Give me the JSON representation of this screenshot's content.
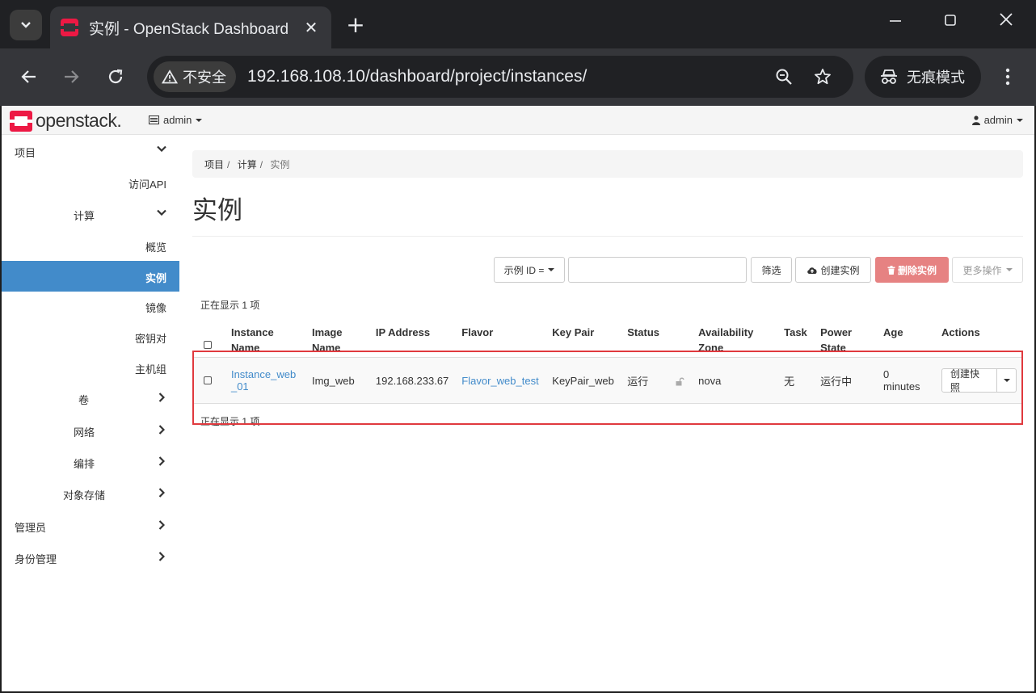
{
  "browser": {
    "tab_title": "实例 - OpenStack Dashboard",
    "security_label": "不安全",
    "url": "192.168.108.10/dashboard/project/instances/",
    "incognito_label": "无痕模式"
  },
  "header": {
    "logo_text": "openstack.",
    "project_label": "admin",
    "user_label": "admin"
  },
  "sidebar": {
    "items": [
      {
        "label": "项目",
        "chevron": "down"
      },
      {
        "label": "访问API"
      },
      {
        "label": "计算",
        "chevron": "down"
      },
      {
        "label": "概览"
      },
      {
        "label": "实例",
        "active": true
      },
      {
        "label": "镜像"
      },
      {
        "label": "密钥对"
      },
      {
        "label": "主机组"
      },
      {
        "label": "卷",
        "chevron": "right"
      },
      {
        "label": "网络",
        "chevron": "right"
      },
      {
        "label": "编排",
        "chevron": "right"
      },
      {
        "label": "对象存储",
        "chevron": "right"
      },
      {
        "label": "管理员",
        "chevron": "right"
      },
      {
        "label": "身份管理",
        "chevron": "right"
      }
    ]
  },
  "breadcrumb": [
    "项目",
    "计算",
    "实例"
  ],
  "page_title": "实例",
  "toolbar": {
    "filter_field": "示例 ID =",
    "filter_value": "",
    "filter_button": "筛选",
    "create_button": "创建实例",
    "delete_button": "删除实例",
    "more_button": "更多操作"
  },
  "table": {
    "count_top": "正在显示 1 项",
    "count_bottom": "正在显示 1 项",
    "headers": {
      "name": [
        "Instance",
        "Name"
      ],
      "image": [
        "Image",
        "Name"
      ],
      "ip": "IP Address",
      "flavor": "Flavor",
      "keypair": "Key Pair",
      "status": "Status",
      "zone": [
        "Availability",
        "Zone"
      ],
      "task": "Task",
      "power": [
        "Power",
        "State"
      ],
      "age": "Age",
      "actions": "Actions"
    },
    "rows": [
      {
        "name": [
          "Instance_web",
          "_01"
        ],
        "image": "Img_web",
        "ip": "192.168.233.67",
        "flavor": "Flavor_web_test",
        "keypair": "KeyPair_web",
        "status": "运行",
        "zone": "nova",
        "task": "无",
        "power": "运行中",
        "age": "0 minutes",
        "action": "创建快照"
      }
    ]
  },
  "colors": {
    "active_nav": "#428bca",
    "link": "#428bca",
    "danger": "#e68282",
    "highlight_box": "#e0393e"
  }
}
